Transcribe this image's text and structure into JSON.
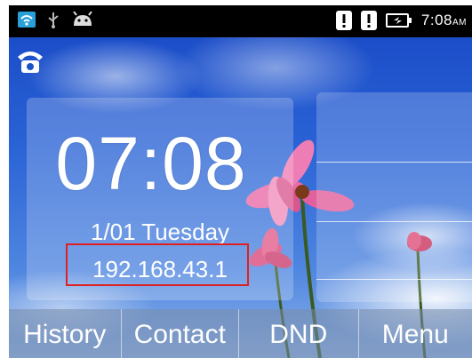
{
  "status_bar": {
    "icons": [
      "wifi-icon",
      "usb-icon",
      "android-icon",
      "alert-icon",
      "alert-icon",
      "battery-charging-icon"
    ],
    "time": "7:08",
    "ampm": "AM"
  },
  "header": {
    "icon": "phone-icon"
  },
  "clock_card": {
    "time": "07:08",
    "date": "1/01 Tuesday",
    "ip_address": "192.168.43.1"
  },
  "softkeys": [
    {
      "label": "History"
    },
    {
      "label": "Contact"
    },
    {
      "label": "DND"
    },
    {
      "label": "Menu"
    }
  ],
  "colors": {
    "status_bar": "#000000",
    "highlight_box": "#e02020",
    "sky": "#1a52c8"
  }
}
